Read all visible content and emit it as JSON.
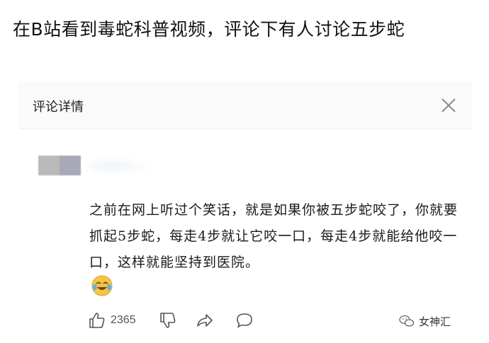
{
  "post": {
    "title": "在B站看到毒蛇科普视频，评论下有人讨论五步蛇"
  },
  "panel": {
    "title": "评论详情",
    "close_icon": "close-icon"
  },
  "comment": {
    "text": "之前在网上听过个笑话，就是如果你被五步蛇咬了，你就要抓起5步蛇，每走4步就让它咬一口，每走4步就能给他咬一口，这样就能坚持到医院。",
    "emoji_icon": "laughing-crying-face-icon"
  },
  "actions": {
    "like_icon": "thumbs-up-icon",
    "like_count": "2365",
    "dislike_icon": "thumbs-down-icon",
    "share_icon": "share-arrow-icon",
    "reply_icon": "comment-bubble-icon"
  },
  "watermark": {
    "icon": "wechat-icon",
    "text": "女神汇"
  },
  "colors": {
    "header_bg": "#fafafa",
    "icon_gray": "#555555",
    "emoji_yellow": "#f5c542"
  }
}
